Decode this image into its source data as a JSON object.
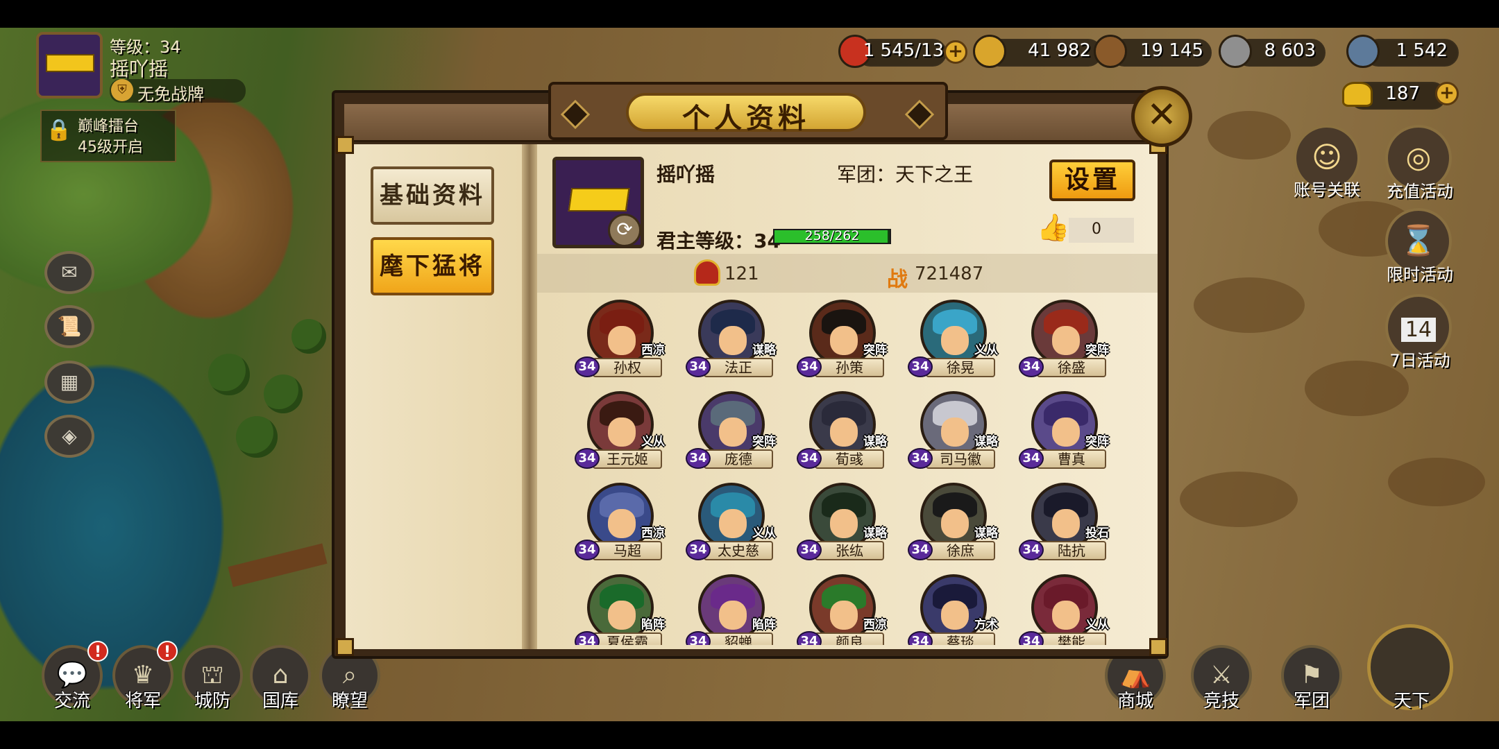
{
  "hud": {
    "player_level_label": "等级：34",
    "player_name": "摇吖摇",
    "badge_text": "无免战牌",
    "arena_line1": "巅峰擂台",
    "arena_line2": "45级开启"
  },
  "resources": [
    {
      "name": "troops",
      "value": "1 545/13",
      "icon": "troop-icon",
      "color": "#c8311f"
    },
    {
      "name": "coins",
      "value": "41 982",
      "icon": "coin-icon",
      "color": "#d9a52c"
    },
    {
      "name": "wood",
      "value": "19 145",
      "icon": "wood-icon",
      "color": "#8a5a2a"
    },
    {
      "name": "stone",
      "value": "8 603",
      "icon": "stone-icon",
      "color": "#8f8f8f"
    },
    {
      "name": "iron",
      "value": "1 542",
      "icon": "iron-icon",
      "color": "#5d7a9a"
    }
  ],
  "gold": {
    "value": "187",
    "icon": "gold-ingot-icon"
  },
  "right_activities": [
    {
      "label": "账号关联",
      "icon": "account-link-icon"
    },
    {
      "label": "充值活动",
      "icon": "recharge-icon"
    },
    {
      "label": "限时活动",
      "icon": "hourglass-icon"
    },
    {
      "label": "7日活动",
      "icon": "calendar-icon",
      "day": "14"
    }
  ],
  "bottom_nav": [
    {
      "label": "交流",
      "icon": "chat-icon",
      "alert": "!"
    },
    {
      "label": "将军",
      "icon": "general-icon",
      "alert": "!"
    },
    {
      "label": "城防",
      "icon": "defense-icon"
    },
    {
      "label": "国库",
      "icon": "treasury-icon"
    },
    {
      "label": "瞭望",
      "icon": "telescope-icon"
    },
    {
      "label": "商城",
      "icon": "shop-icon"
    },
    {
      "label": "竞技",
      "icon": "arena-icon"
    },
    {
      "label": "军团",
      "icon": "legion-icon"
    },
    {
      "label": "天下",
      "icon": "world-icon"
    }
  ],
  "modal": {
    "title": "个人资料",
    "close_icon": "close-icon",
    "tabs": [
      {
        "label": "基础资料",
        "active": false
      },
      {
        "label": "麾下猛将",
        "active": true
      }
    ],
    "profile": {
      "name": "摇吖摇",
      "legion": "军团：天下之王",
      "level_label": "君主等级：34",
      "xp_text": "258/262",
      "xp_current": 258,
      "xp_max": 262,
      "settings_label": "设置",
      "likes": "0",
      "heroes_count": "121",
      "power": "721487",
      "power_glyph": "战"
    },
    "heroes": [
      {
        "name": "孙权",
        "level": "34",
        "class": "西凉",
        "hair": "#7a1e12",
        "bg": "#7a2a1a"
      },
      {
        "name": "法正",
        "level": "34",
        "class": "谋略",
        "hair": "#1e2a4a",
        "bg": "#3a3a5a"
      },
      {
        "name": "孙策",
        "level": "34",
        "class": "突阵",
        "hair": "#1a1410",
        "bg": "#5a2a1a"
      },
      {
        "name": "徐晃",
        "level": "34",
        "class": "义从",
        "hair": "#3aa5c8",
        "bg": "#2a6a7a"
      },
      {
        "name": "徐盛",
        "level": "34",
        "class": "突阵",
        "hair": "#9a2a1a",
        "bg": "#6a3a3a"
      },
      {
        "name": "王元姬",
        "level": "34",
        "class": "义从",
        "hair": "#3a1a12",
        "bg": "#7a3a3a"
      },
      {
        "name": "庞德",
        "level": "34",
        "class": "突阵",
        "hair": "#5a6a7a",
        "bg": "#4a3a6a"
      },
      {
        "name": "荀彧",
        "level": "34",
        "class": "谋略",
        "hair": "#2a2a3a",
        "bg": "#3a3a4a"
      },
      {
        "name": "司马徽",
        "level": "34",
        "class": "谋略",
        "hair": "#c8c8d0",
        "bg": "#6a6a7a"
      },
      {
        "name": "曹真",
        "level": "34",
        "class": "突阵",
        "hair": "#3a2a6a",
        "bg": "#5a4a8a"
      },
      {
        "name": "马超",
        "level": "34",
        "class": "西凉",
        "hair": "#5a6aaa",
        "bg": "#3a4a8a"
      },
      {
        "name": "太史慈",
        "level": "34",
        "class": "义从",
        "hair": "#2a8aa8",
        "bg": "#2a5a7a"
      },
      {
        "name": "张纮",
        "level": "34",
        "class": "谋略",
        "hair": "#1a2a1a",
        "bg": "#3a4a3a"
      },
      {
        "name": "徐庶",
        "level": "34",
        "class": "谋略",
        "hair": "#1a1a1a",
        "bg": "#4a4a3a"
      },
      {
        "name": "陆抗",
        "level": "34",
        "class": "投石",
        "hair": "#1a1a2a",
        "bg": "#3a3a4a"
      },
      {
        "name": "夏侯霸",
        "level": "34",
        "class": "陷阵",
        "hair": "#1a6a2a",
        "bg": "#4a6a3a"
      },
      {
        "name": "貂蝉",
        "level": "34",
        "class": "陷阵",
        "hair": "#6a2a8a",
        "bg": "#6a3a7a"
      },
      {
        "name": "颜良",
        "level": "34",
        "class": "西凉",
        "hair": "#2a7a2a",
        "bg": "#7a3a2a"
      },
      {
        "name": "蔡琰",
        "level": "34",
        "class": "方术",
        "hair": "#1a1a3a",
        "bg": "#3a3a6a"
      },
      {
        "name": "樊能",
        "level": "34",
        "class": "义从",
        "hair": "#6a1a2a",
        "bg": "#7a2a3a"
      }
    ]
  }
}
